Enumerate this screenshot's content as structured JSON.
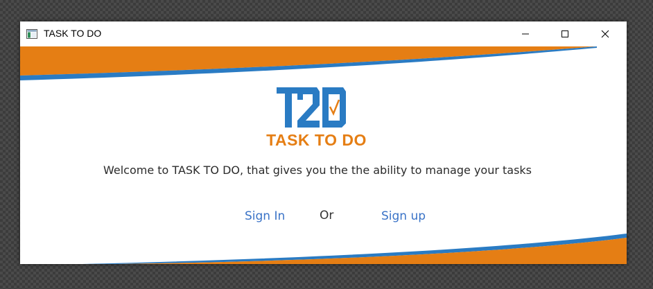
{
  "window": {
    "title": "TASK TO DO"
  },
  "brand": {
    "logo_text": "T2O",
    "name": "TASK TO DO"
  },
  "main": {
    "welcome": "Welcome to TASK TO DO, that gives you the the ability to manage your tasks",
    "sign_in": "Sign In",
    "or": "Or",
    "sign_up": "Sign up"
  },
  "colors": {
    "orange": "#e57e14",
    "blue": "#2a7bc3",
    "link": "#3a73c7"
  },
  "icons": {
    "app": "app-window-icon",
    "minimize": "minimize-icon",
    "maximize": "maximize-icon",
    "close": "close-icon"
  }
}
